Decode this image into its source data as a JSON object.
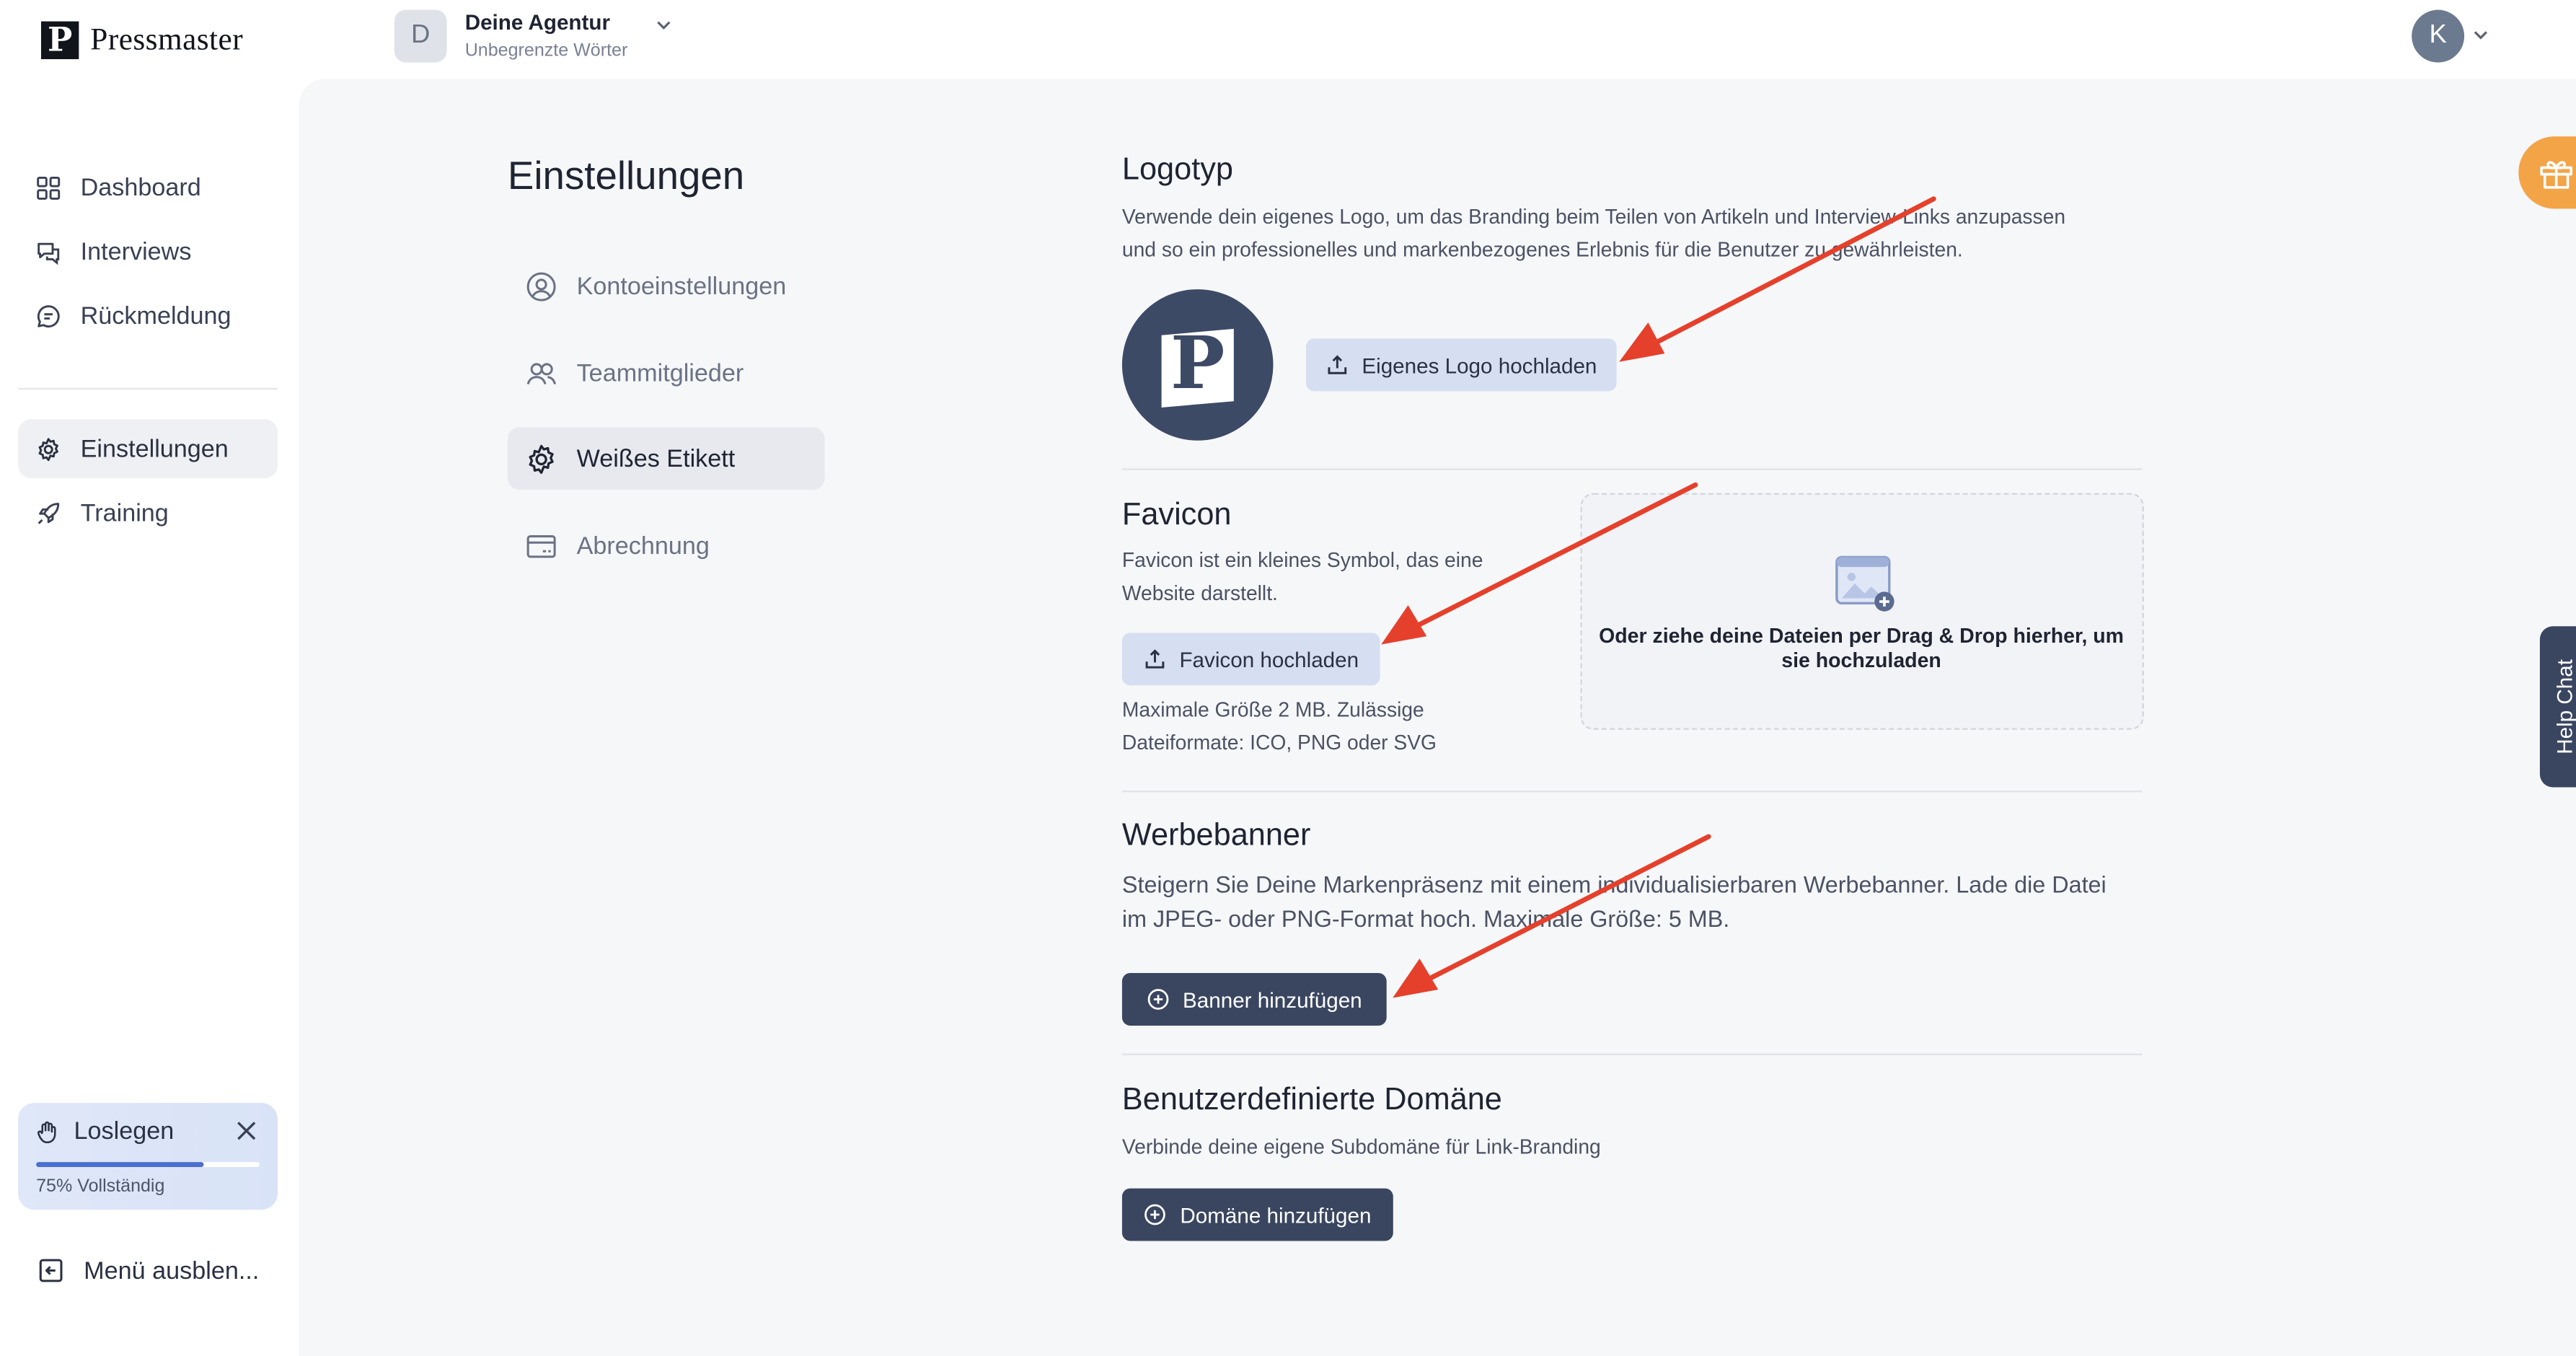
{
  "app": {
    "brand_mark": "P",
    "brand_name": "Pressmaster"
  },
  "header": {
    "agency_initial": "D",
    "agency_name": "Deine Agentur",
    "agency_plan": "Unbegrenzte Wörter",
    "user_initial": "K"
  },
  "sidebar": {
    "items": [
      {
        "label": "Dashboard",
        "icon": "dashboard-icon"
      },
      {
        "label": "Interviews",
        "icon": "chat-icon"
      },
      {
        "label": "Rückmeldung",
        "icon": "message-icon"
      },
      {
        "label": "Einstellungen",
        "icon": "gear-icon",
        "active": true
      },
      {
        "label": "Training",
        "icon": "rocket-icon"
      }
    ],
    "onboarding": {
      "title": "Loslegen",
      "progress_text": "75% Vollständig",
      "progress": 0.75
    },
    "collapse_label": "Menü ausblen..."
  },
  "settings": {
    "title": "Einstellungen",
    "menu": [
      {
        "label": "Kontoeinstellungen",
        "icon": "user-circle-icon"
      },
      {
        "label": "Teammitglieder",
        "icon": "team-icon"
      },
      {
        "label": "Weißes Etikett",
        "icon": "gear-icon",
        "active": true
      },
      {
        "label": "Abrechnung",
        "icon": "card-icon"
      }
    ]
  },
  "logotyp": {
    "title": "Logotyp",
    "description_1": "Verwende dein eigenes Logo, um das Branding beim Teilen von Artikeln und Interview-Links anzupassen",
    "description_2": "und so ein professionelles und markenbezogenes Erlebnis für die Benutzer zu gewährleisten.",
    "logo_letter": "P",
    "upload_label": "Eigenes Logo hochladen"
  },
  "favicon": {
    "title": "Favicon",
    "description_1": "Favicon ist ein kleines Symbol, das eine",
    "description_2": "Website darstellt.",
    "upload_label": "Favicon hochladen",
    "hint_1": "Maximale Größe 2 MB. Zulässige",
    "hint_2": "Dateiformate: ICO, PNG oder SVG",
    "dropzone_1": "Oder ziehe deine Dateien per Drag & Drop hierher, um",
    "dropzone_2": "sie hochzuladen"
  },
  "banner": {
    "title": "Werbebanner",
    "description_1": "Steigern Sie Deine Markenpräsenz mit einem individualisierbaren Werbebanner. Lade die Datei",
    "description_2": "im JPEG- oder PNG-Format hoch. Maximale Größe: 5 MB.",
    "add_label": "Banner hinzufügen"
  },
  "domain": {
    "title": "Benutzerdefinierte Domäne",
    "description": "Verbinde deine eigene Subdomäne für Link-Branding",
    "add_label": "Domäne hinzufügen"
  },
  "widgets": {
    "help_chat": "Help Chat",
    "gift_icon": "gift-icon"
  },
  "colors": {
    "accent_dark": "#3a4660",
    "accent_light": "#d6def2",
    "annotation_arrow": "#e5402b",
    "gift": "#f3a447"
  }
}
